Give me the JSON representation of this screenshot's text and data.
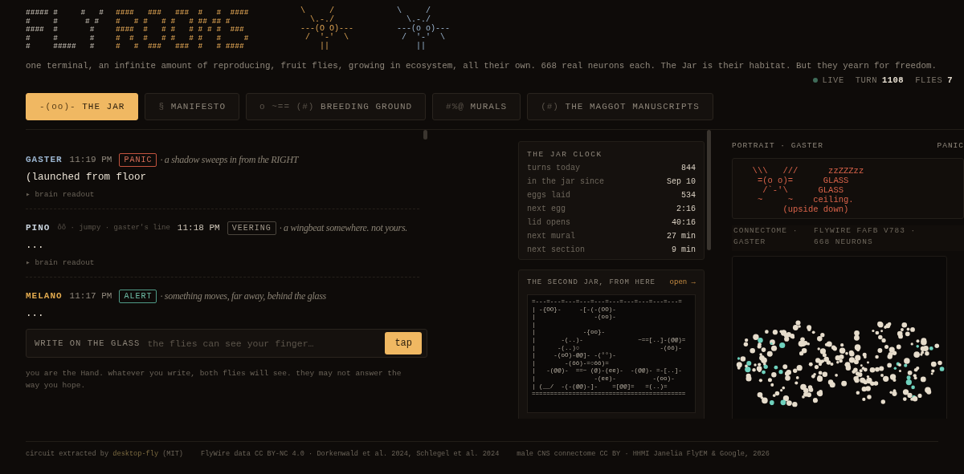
{
  "logo": {
    "left_lines": [
      "##### #     #   #",
      "#     #      # # ",
      "####  #       #  ",
      "#     #       #  ",
      "#     #####   #  "
    ],
    "right_lines": [
      "####   ###   ###  #   #  ####",
      "#   # #   # #   # ## ## #    ",
      "####  #   # #   # # # #  ### ",
      "#  #  #   # #   # #   #     #",
      "#   #  ###   ###  #   # #### "
    ]
  },
  "mascots": [
    {
      "lines": [
        "\\     /",
        "  \\.-./  ",
        "---(O O)---",
        " /  '-'  \\ ",
        "    ||    "
      ]
    },
    {
      "lines": [
        "\\     /",
        "  \\.-./  ",
        "---(o o)---",
        " /  '-'  \\ ",
        "    ||    "
      ]
    }
  ],
  "tagline": "one terminal, an infinite amount of reproducing, fruit flies, growing in ecosystem, all their own. 668 real neurons each. The Jar is their habitat. But they yearn for freedom.",
  "status": {
    "live": true,
    "live_label": "LIVE",
    "turn_label": "TURN",
    "turn": "1108",
    "flies_label": "FLIES",
    "flies": "7"
  },
  "tabs": [
    {
      "icon": "-(oo)-",
      "label": "THE JAR",
      "selected": true
    },
    {
      "icon": "§",
      "label": "MANIFESTO",
      "selected": false
    },
    {
      "icon": "o ~== (#)",
      "label": "BREEDING GROUND",
      "selected": false
    },
    {
      "icon": "#%@",
      "label": "MURALS",
      "selected": false
    },
    {
      "icon": "(#)",
      "label": "THE MAGGOT MANUSCRIPTS",
      "selected": false
    }
  ],
  "feed": [
    {
      "name": "GASTER",
      "color": "#9ab4cf",
      "time": "11:19 PM",
      "badge": {
        "kind": "panic",
        "label": "PANIC"
      },
      "note": "· a shadow sweeps in from the RIGHT",
      "body": "(launched from floor",
      "readout": "▸ brain readout"
    },
    {
      "name": "PINO",
      "color": "#c8d2dc",
      "meta": "ôô · jumpy · gaster's line",
      "time": "11:18 PM",
      "badge": {
        "kind": "veering",
        "label": "VEERING"
      },
      "note": "· a wingbeat somewhere. not yours.",
      "body": "...",
      "readout": "▸ brain readout"
    },
    {
      "name": "MELANO",
      "color": "#e0a94e",
      "time": "11:17 PM",
      "badge": {
        "kind": "alert",
        "label": "ALERT"
      },
      "note": "· something moves, far away, behind the glass",
      "body": "..."
    }
  ],
  "write": {
    "label": "WRITE ON THE GLASS",
    "placeholder": "the flies can see your finger…",
    "button": "tap",
    "hint": "you are the Hand. whatever you write, both flies will see. they may not answer the way you hope."
  },
  "clock": {
    "title": "THE JAR CLOCK",
    "rows": [
      {
        "label": "turns today",
        "value": "844"
      },
      {
        "label": "in the jar since",
        "value": "Sep 10"
      },
      {
        "label": "eggs laid",
        "value": "534"
      },
      {
        "label": "next egg",
        "value": "2:16"
      },
      {
        "label": "lid opens",
        "value": "40:16"
      },
      {
        "label": "next mural",
        "value": "27 min"
      },
      {
        "label": "next section",
        "value": "9 min"
      }
    ]
  },
  "second_jar": {
    "title": "THE SECOND JAR, FROM HERE",
    "link": "open →",
    "lines": [
      "=---=---=---=---=---=---=---=---=---=---=",
      "| -{OO}-     -[-(-(OO)-",
      "|                -(oo)-",
      "|",
      "|             -{oo}-",
      "|       -(..)-               ~==[..]-(@@)=",
      "|      -(..)○                      -(ôô)-",
      "|     -(oO)-@@]- -(°°)-",
      "|        -(ôô)-=○ôô)=",
      "|   -(@@)-  ==~ (@)-(ee)-  -(@@)- =-[..]-",
      "|                -(ee)-          -(oo)-",
      "| (__/  -(-(@@)-]-    =[@@]=   =(..)=",
      "=========================================="
    ]
  },
  "portrait": {
    "title": "PORTRAIT · GASTER",
    "mood": "PANIC",
    "lines": [
      "  \\\\\\   ///      zzZZZzz",
      "   =(o o)=      GLASS",
      "    /`-'\\      GLASS",
      "   ~     ~    ceiling.",
      "        (upside down)"
    ]
  },
  "connectome": {
    "title": "CONNECTOME · GASTER",
    "source": "FLYWIRE FAFB V783 · 668 NEURONS"
  },
  "footer": [
    {
      "text": "circuit extracted by ",
      "link": "desktop-fly",
      "after": " (MIT)"
    },
    {
      "text": "FlyWire data CC BY-NC 4.0 · Dorkenwald et al. 2024, Schlegel et al. 2024"
    },
    {
      "text": "male CNS connectome CC BY · HHMI Janelia FlyEM & Google, 2026"
    }
  ]
}
